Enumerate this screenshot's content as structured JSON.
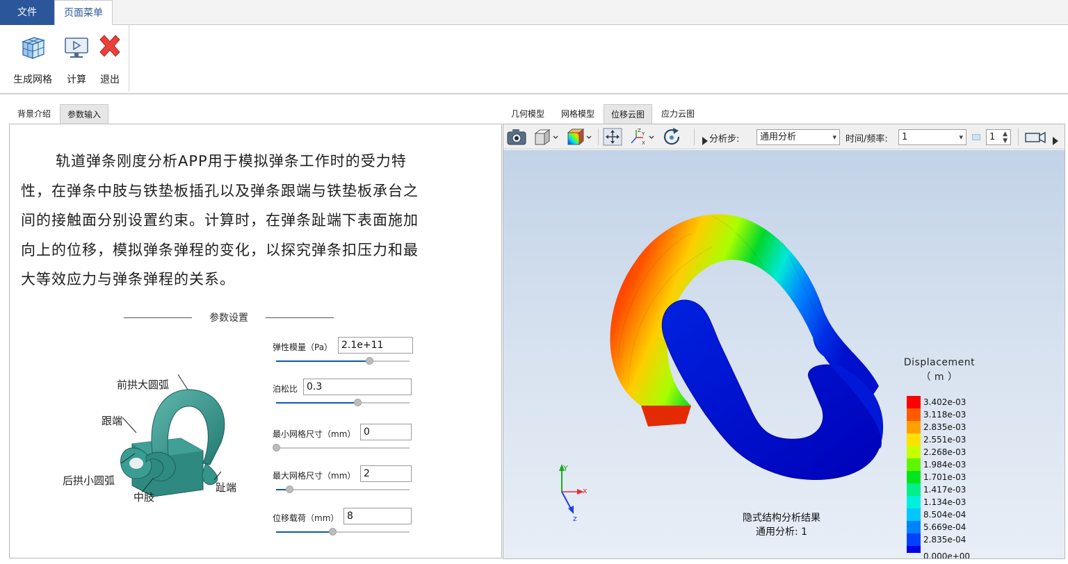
{
  "menu": {
    "file": "文件",
    "page_menu": "页面菜单"
  },
  "ribbon": {
    "mesh": "生成网格",
    "calc": "计算",
    "exit": "退出"
  },
  "left_tabs": [
    "背景介绍",
    "参数输入"
  ],
  "intro_text": "轨道弹条刚度分析APP用于模拟弹条工作时的受力特性，在弹条中肢与铁垫板插孔以及弹条跟端与铁垫板承台之间的接触面分别设置约束。计算时，在弹条趾端下表面施加向上的位移，模拟弹条弹程的变化，以探究弹条扣压力和最大等效应力与弹条弹程的关系。",
  "param_section_title": "参数设置",
  "figure_labels": {
    "front_arc": "前拱大圆弧",
    "heel": "跟端",
    "rear_arc": "后拱小圆弧",
    "middle": "中肢",
    "toe": "趾端"
  },
  "params": [
    {
      "label": "弹性模量（Pa）",
      "value": "2.1e+11",
      "slider": 0.7
    },
    {
      "label": "泊松比",
      "value": "0.3",
      "slider": 0.61
    },
    {
      "label": "最小网格尺寸（mm）",
      "value": "0",
      "slider": 0.0
    },
    {
      "label": "最大网格尺寸（mm）",
      "value": "2",
      "slider": 0.1
    },
    {
      "label": "位移载荷（mm）",
      "value": "8",
      "slider": 0.42
    }
  ],
  "right_tabs": [
    "几何模型",
    "网格模型",
    "位移云图",
    "应力云图"
  ],
  "toolbar": {
    "step_label": "分析步:",
    "step_value": "通用分析",
    "time_label": "时间/频率:",
    "time_value": "1",
    "spin_value": "1"
  },
  "legend": {
    "title": "Displacement",
    "unit": "（ m ）",
    "values": [
      "3.402e-03",
      "3.118e-03",
      "2.835e-03",
      "2.551e-03",
      "2.268e-03",
      "1.984e-03",
      "1.701e-03",
      "1.417e-03",
      "1.134e-03",
      "8.504e-04",
      "5.669e-04",
      "2.835e-04",
      "0.000e+00"
    ],
    "colors": [
      "#ff0000",
      "#ff5a00",
      "#ff9f00",
      "#ffe100",
      "#c7ff00",
      "#5ff500",
      "#00e61e",
      "#00f08c",
      "#00f0dc",
      "#00c8ff",
      "#0082ff",
      "#0041ff",
      "#0000e6"
    ]
  },
  "result_caption": {
    "line1": "隐式结构分析结果",
    "line2": "通用分析: 1"
  },
  "axes": {
    "x": "x",
    "y": "Y",
    "z": "z"
  }
}
